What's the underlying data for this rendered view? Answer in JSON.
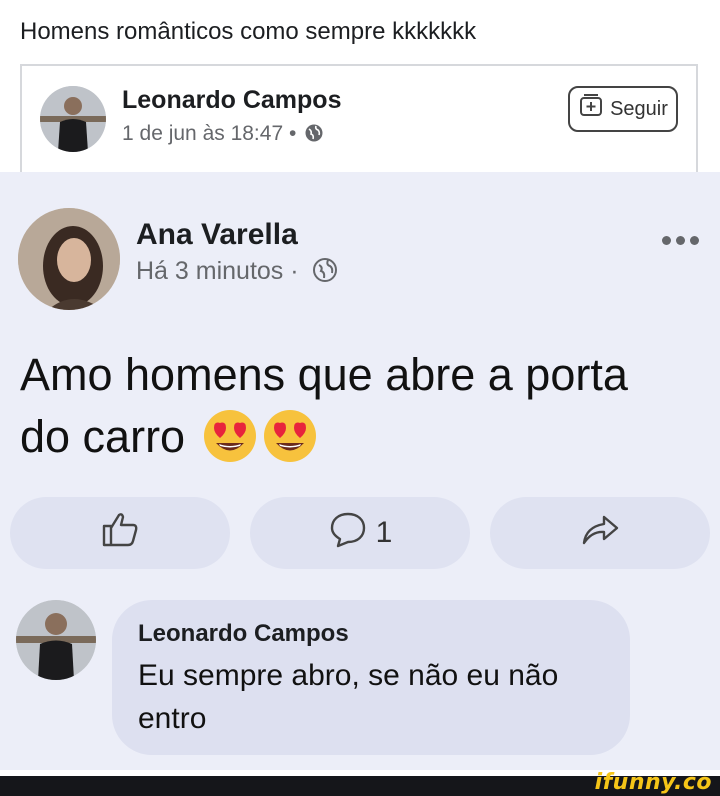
{
  "caption": "Homens românticos como sempre kkkkkkk",
  "shared_post": {
    "author": "Leonardo Campos",
    "timestamp": "1 de jun às 18:47 •",
    "privacy_icon": "globe-icon",
    "follow_label": "Seguir"
  },
  "original_post": {
    "author": "Ana Varella",
    "timestamp": "Há 3 minutos ·",
    "privacy_icon": "globe-icon",
    "text": "Amo homens que abre a porta do carro",
    "emojis": [
      "heart-eyes-emoji",
      "heart-eyes-emoji"
    ],
    "actions": {
      "like_icon": "thumbs-up-icon",
      "comment_icon": "comment-icon",
      "comment_count": "1",
      "share_icon": "share-icon"
    }
  },
  "comment": {
    "author": "Leonardo Campos",
    "text": "Eu sempre abro, se não eu não entro"
  },
  "watermark": "ifunny.co",
  "colors": {
    "post_background": "#eceef8",
    "action_pill": "#dfe2f1",
    "comment_bubble": "#dde0f0",
    "watermark": "#f5c518"
  }
}
